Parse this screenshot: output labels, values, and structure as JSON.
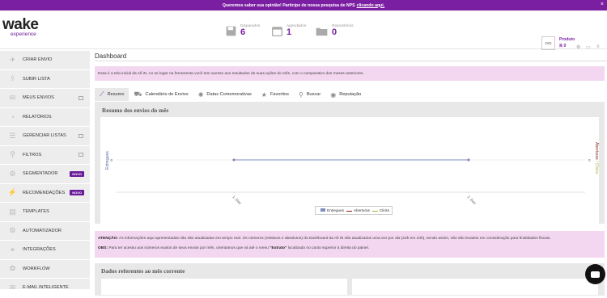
{
  "nps_bar": {
    "text": "Queremos saber sua opinião! Participe de nossa pesquisa de NPS",
    "link": "clicando aqui.",
    "close": "×"
  },
  "header": {
    "logo": {
      "word": "wake",
      "sub": "experience"
    },
    "stats": [
      {
        "label": "Disparados",
        "value": "6"
      },
      {
        "label": "Agendados",
        "value": "1"
      },
      {
        "label": "Repositórios",
        "value": "0"
      }
    ],
    "profile_initials": "OIG",
    "product": {
      "label": "Produto",
      "value": "ℝ 0"
    }
  },
  "sidebar": {
    "items": [
      {
        "label": "CRIAR ENVIO",
        "icon": "send-icon"
      },
      {
        "label": "SUBIR LISTA",
        "icon": "upload-icon"
      },
      {
        "label": "MEUS ENVIOS",
        "icon": "mail-icon",
        "checkbox": true
      },
      {
        "label": "RELATÓRIOS",
        "icon": "chart-icon"
      },
      {
        "label": "GERENCIAR LISTAS",
        "icon": "list-icon",
        "checkbox": true
      },
      {
        "label": "FILTROS",
        "icon": "filter-icon",
        "checkbox": true
      },
      {
        "label": "SEGMENTADOR",
        "icon": "segment-icon",
        "badge": "NOVO"
      },
      {
        "label": "RECOMENDAÇÕES",
        "icon": "recommend-icon",
        "badge": "NOVO"
      },
      {
        "label": "TEMPLATES",
        "icon": "template-icon"
      },
      {
        "label": "AUTOMATIZADOR",
        "icon": "automation-icon"
      },
      {
        "label": "INTEGRAÇÕES",
        "icon": "integration-icon"
      },
      {
        "label": "WORKFLOW",
        "icon": "workflow-icon"
      },
      {
        "label": "E-MAIL INTELIGENTE",
        "icon": "smart-mail-icon"
      }
    ]
  },
  "main": {
    "title": "Dashboard",
    "info": "Essa é a tela inicial da All iN. Ao se logar na ferramenta você tem acesso aos resultados de suas ações do mês, com o comparativo dos meses anteriores.",
    "tabs": [
      {
        "label": "Resumo",
        "icon": "chart-line-icon",
        "active": true
      },
      {
        "label": "Calendário de Envios",
        "icon": "truck-icon"
      },
      {
        "label": "Datas Comemorativas",
        "icon": "party-icon"
      },
      {
        "label": "Favoritos",
        "icon": "star-icon"
      },
      {
        "label": "Buscar",
        "icon": "search-icon"
      },
      {
        "label": "Reputação",
        "icon": "reputation-icon"
      }
    ],
    "summary_title": "Resumo dos envios do mês",
    "warning": {
      "l1_bold": "ATENÇÃO:",
      "l1": "As informações aqui apresentadas não são atualizadas em tempo real. Os números (relativos e absolutos) do Dashboard da All iN são atualizados uma vez por dia (24h em 24h), sendo assim, não são levados em consideração para finalidades fiscais.",
      "l2_bold": "OBS:",
      "l2a": "Para ter acesso aos números exatos de seus envios por mês, orientamos que vá até o menu",
      "l2b": "\"Extrato\"",
      "l2c": "localizado no canto superior à direita do painel."
    },
    "data_title": "Dados referentes ao mês corrente"
  },
  "chart_data": {
    "type": "line",
    "x": [
      "1. Dez",
      "2. Dez"
    ],
    "series": [
      {
        "name": "Entregues",
        "values": [
          0,
          0
        ],
        "color": "#7e8dbf"
      },
      {
        "name": "Aberturas",
        "values": [
          0,
          0
        ],
        "color": "#8b1c1c"
      },
      {
        "name": "Clicks",
        "values": [
          0,
          0
        ],
        "color": "#9bb53c"
      }
    ],
    "ylabel_left": "Entregues",
    "ylabel_right": "Aberturas / Clicks",
    "y_left_tick": "0",
    "y_right_tick": "0",
    "legend": "bottom-center"
  }
}
